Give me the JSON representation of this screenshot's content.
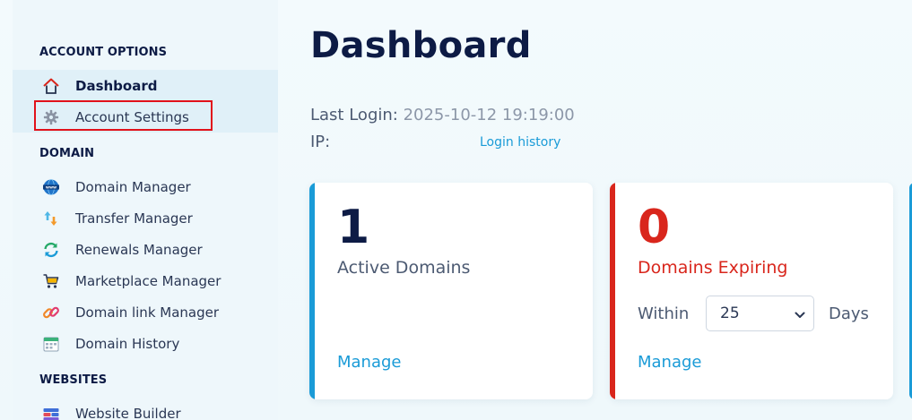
{
  "sidebar": {
    "sections": {
      "account": "ACCOUNT OPTIONS",
      "domain": "DOMAIN",
      "websites": "WEBSITES"
    },
    "items": {
      "dashboard": "Dashboard",
      "account_settings": "Account Settings",
      "domain_manager": "Domain Manager",
      "transfer_manager": "Transfer Manager",
      "renewals_manager": "Renewals Manager",
      "marketplace_manager": "Marketplace Manager",
      "domain_link_manager": "Domain link Manager",
      "domain_history": "Domain History",
      "website_builder": "Website Builder"
    }
  },
  "main": {
    "title": "Dashboard",
    "last_login_label": "Last Login:",
    "last_login_value": "2025-10-12 19:19:00",
    "ip_label": "IP:",
    "login_history": "Login history",
    "cards": {
      "active": {
        "count": "1",
        "label": "Active Domains",
        "manage": "Manage"
      },
      "expiring": {
        "count": "0",
        "label": "Domains Expiring",
        "within": "Within",
        "selected_days": "25",
        "days": "Days",
        "manage": "Manage"
      }
    }
  },
  "colors": {
    "navy": "#0d1b45",
    "accent_blue": "#1a9bd7",
    "alert_red": "#d9261c",
    "highlight_red": "#e1121b"
  },
  "icons": {
    "dashboard": "home-icon",
    "account_settings": "gear-icon",
    "domain_manager": "www-globe-icon",
    "transfer_manager": "transfer-arrows-icon",
    "renewals_manager": "refresh-icon",
    "marketplace_manager": "cart-icon",
    "domain_link_manager": "link-icon",
    "domain_history": "calendar-icon",
    "website_builder": "website-builder-icon"
  }
}
